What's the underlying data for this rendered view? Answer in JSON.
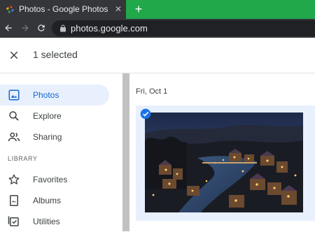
{
  "browser": {
    "tab_title": "Photos - Google Photos",
    "tab_close_glyph": "✕",
    "new_tab_glyph": "+",
    "url": "photos.google.com",
    "icons": [
      "google-photos-favicon",
      "back-arrow-icon",
      "forward-arrow-icon",
      "reload-icon",
      "lock-icon"
    ]
  },
  "selection_bar": {
    "count_label": "1 selected",
    "close_icon": "close-icon"
  },
  "sidebar": {
    "items": [
      {
        "label": "Photos",
        "icon": "photo-icon",
        "active": true
      },
      {
        "label": "Explore",
        "icon": "search-icon",
        "active": false
      },
      {
        "label": "Sharing",
        "icon": "people-icon",
        "active": false
      }
    ],
    "library_heading": "LIBRARY",
    "library_items": [
      {
        "label": "Favorites",
        "icon": "star-icon"
      },
      {
        "label": "Albums",
        "icon": "album-icon"
      },
      {
        "label": "Utilities",
        "icon": "utilities-icon"
      }
    ]
  },
  "main": {
    "date_group": "Fri, Oct 1",
    "photos": [
      {
        "selected": true,
        "subject": "night town river photo"
      }
    ]
  },
  "colors": {
    "tabstrip": "#20a84a",
    "chrome_dark": "#35363a",
    "omnibox": "#202124",
    "active_nav_bg": "#e8f0fe",
    "active_nav_text": "#1967d2",
    "selection_check": "#1a73e8"
  }
}
